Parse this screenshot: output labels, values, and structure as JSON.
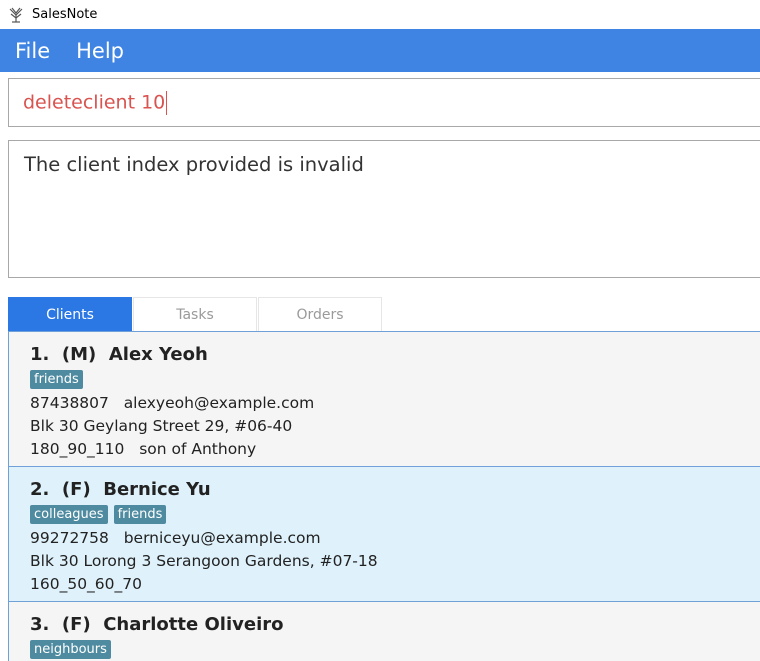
{
  "window": {
    "title": "SalesNote",
    "icon": "app-logo-icon"
  },
  "menu": {
    "items": [
      "File",
      "Help"
    ]
  },
  "command": {
    "value": "deleteclient 10"
  },
  "result": {
    "message": "The client index provided is invalid"
  },
  "tabs": [
    {
      "label": "Clients",
      "active": true
    },
    {
      "label": "Tasks",
      "active": false
    },
    {
      "label": "Orders",
      "active": false
    }
  ],
  "clients": [
    {
      "index": "1.",
      "gender": "(M)",
      "name": "Alex Yeoh",
      "tags": [
        "friends"
      ],
      "phone": "87438807",
      "email": "alexyeoh@example.com",
      "address": "Blk 30 Geylang Street 29, #06-40",
      "size": "180_90_110",
      "remark": "son of Anthony"
    },
    {
      "index": "2.",
      "gender": "(F)",
      "name": "Bernice Yu",
      "tags": [
        "colleagues",
        "friends"
      ],
      "phone": "99272758",
      "email": "berniceyu@example.com",
      "address": "Blk 30 Lorong 3 Serangoon Gardens, #07-18",
      "size": "160_50_60_70",
      "remark": ""
    },
    {
      "index": "3.",
      "gender": "(F)",
      "name": "Charlotte Oliveiro",
      "tags": [
        "neighbours"
      ]
    }
  ],
  "colors": {
    "menubar": "#3f84e3",
    "active_tab": "#2b78e4",
    "tag": "#4f8ba0",
    "command_text": "#d9534f",
    "selected_card": "#dff2fb"
  }
}
